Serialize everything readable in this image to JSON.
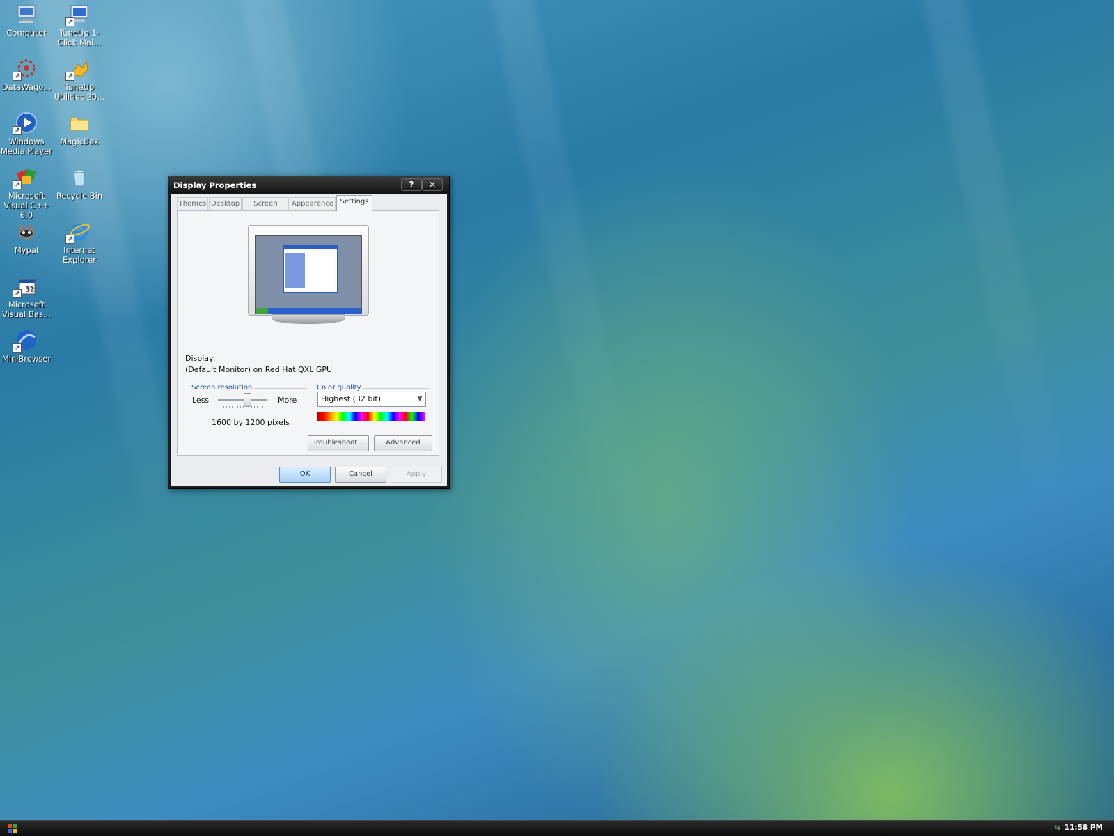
{
  "desktop": {
    "icons": [
      {
        "label": "Computer",
        "icon": "computer-icon"
      },
      {
        "label": "TuneUp 1-Click Mai...",
        "icon": "tuneup-oneclick-icon"
      },
      {
        "label": "DataWago...",
        "icon": "datawagon-icon"
      },
      {
        "label": "TuneUp Utilities 20...",
        "icon": "tuneup-utilities-icon"
      },
      {
        "label": "Windows Media Player",
        "icon": "media-player-icon"
      },
      {
        "label": "MagicBox",
        "icon": "folder-icon"
      },
      {
        "label": "Microsoft Visual C++ 6.0",
        "icon": "visual-cpp-icon"
      },
      {
        "label": "Recycle Bin",
        "icon": "recycle-bin-icon"
      },
      {
        "label": "Mypal",
        "icon": "mypal-icon"
      },
      {
        "label": "Internet Explorer",
        "icon": "internet-explorer-icon"
      },
      {
        "label": "Microsoft Visual Bas...",
        "icon": "visual-basic-icon"
      },
      {
        "label": "MiniBrowser",
        "icon": "minibrowser-icon"
      }
    ]
  },
  "dialog": {
    "title": "Display Properties",
    "help_glyph": "?",
    "close_glyph": "✕",
    "tabs": [
      "Themes",
      "Desktop",
      "Screen Saver",
      "Appearance",
      "Settings"
    ],
    "active_tab": "Settings",
    "display_label": "Display:",
    "display_value": "(Default Monitor) on Red Hat QXL GPU",
    "screen_resolution": {
      "title": "Screen resolution",
      "less": "Less",
      "more": "More",
      "value_text": "1600 by 1200 pixels",
      "slider_level": 0.6
    },
    "color_quality": {
      "title": "Color quality",
      "selected": "Highest (32 bit)",
      "arrow_glyph": "▼"
    },
    "buttons": {
      "troubleshoot": "Troubleshoot...",
      "advanced": "Advanced",
      "ok": "OK",
      "cancel": "Cancel",
      "apply": "Apply"
    }
  },
  "taskbar": {
    "clock": "11:58 PM"
  },
  "colors": {
    "start_flag": [
      "#e84a1c",
      "#3fa33f",
      "#2b6fd6",
      "#f2c01c"
    ]
  }
}
